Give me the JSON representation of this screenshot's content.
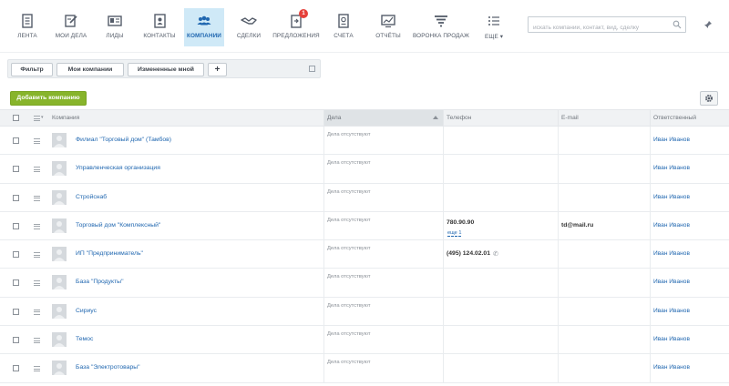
{
  "nav": {
    "items": [
      {
        "key": "feed",
        "label": "ЛЕНТА",
        "icon": "feed-icon"
      },
      {
        "key": "tasks",
        "label": "МОИ ДЕЛА",
        "icon": "tasks-icon"
      },
      {
        "key": "leads",
        "label": "ЛИДЫ",
        "icon": "leads-icon"
      },
      {
        "key": "contacts",
        "label": "КОНТАКТЫ",
        "icon": "contacts-icon"
      },
      {
        "key": "companies",
        "label": "КОМПАНИИ",
        "icon": "companies-icon",
        "active": true
      },
      {
        "key": "deals",
        "label": "СДЕЛКИ",
        "icon": "handshake-icon"
      },
      {
        "key": "quotes",
        "label": "ПРЕДЛОЖЕНИЯ",
        "icon": "quotes-icon",
        "badge": "1"
      },
      {
        "key": "invoices",
        "label": "СЧЕТА",
        "icon": "invoice-icon"
      },
      {
        "key": "reports",
        "label": "ОТЧЁТЫ",
        "icon": "reports-icon"
      },
      {
        "key": "funnel",
        "label": "ВОРОНКА ПРОДАЖ",
        "icon": "funnel-icon"
      },
      {
        "key": "more",
        "label": "ЕЩЕ ▾",
        "icon": "list-icon"
      }
    ],
    "search_placeholder": "искать компании, контакт, вид, сделку"
  },
  "filters": {
    "filter_label": "Фильтр",
    "my_companies_label": "Мои компании",
    "changed_by_me_label": "Измененные мной",
    "add_label": "+"
  },
  "toolbar": {
    "add_company_label": "Добавить компанию"
  },
  "grid": {
    "columns": {
      "company": "Компания",
      "deals": "Дела",
      "phone": "Телефон",
      "email": "E-mail",
      "responsible": "Ответственный"
    },
    "rows": [
      {
        "name": "Филиал \"Торговый дом\" (Тамбов)",
        "deals": "Дела отсутствуют",
        "phone": "",
        "phone_more": "",
        "email": "",
        "responsible": "Иван Иванов"
      },
      {
        "name": "Управленческая организация",
        "deals": "Дела отсутствуют",
        "phone": "",
        "phone_more": "",
        "email": "",
        "responsible": "Иван Иванов"
      },
      {
        "name": "Стройснаб",
        "deals": "Дела отсутствуют",
        "phone": "",
        "phone_more": "",
        "email": "",
        "responsible": "Иван Иванов"
      },
      {
        "name": "Торговый дом \"Комплексный\"",
        "deals": "Дела отсутствуют",
        "phone": "780.90.90",
        "phone_more": "еще 1",
        "email": "td@mail.ru",
        "responsible": "Иван Иванов"
      },
      {
        "name": "ИП \"Предприниматель\"",
        "deals": "Дела отсутствуют",
        "phone": "(495) 124.02.01",
        "phone_more": "",
        "email": "",
        "responsible": "Иван Иванов"
      },
      {
        "name": "База \"Продукты\"",
        "deals": "Дела отсутствуют",
        "phone": "",
        "phone_more": "",
        "email": "",
        "responsible": "Иван Иванов"
      },
      {
        "name": "Сириус",
        "deals": "Дела отсутствуют",
        "phone": "",
        "phone_more": "",
        "email": "",
        "responsible": "Иван Иванов"
      },
      {
        "name": "Темос",
        "deals": "Дела отсутствуют",
        "phone": "",
        "phone_more": "",
        "email": "",
        "responsible": "Иван Иванов"
      },
      {
        "name": "База \"Электротовары\"",
        "deals": "Дела отсутствуют",
        "phone": "",
        "phone_more": "",
        "email": "",
        "responsible": "Иван Иванов"
      }
    ]
  },
  "colors": {
    "link": "#2067b0",
    "accent_green": "#87b42b",
    "active_tab_bg": "#cfe9f7",
    "badge_red": "#e5403a"
  }
}
